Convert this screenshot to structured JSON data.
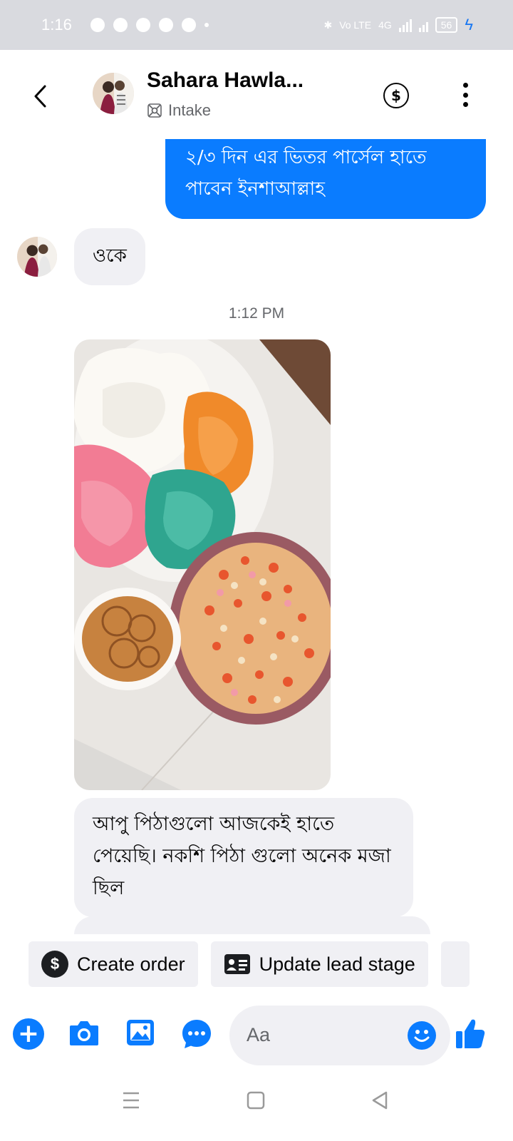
{
  "status_bar": {
    "time": "1:16",
    "network_label": "Vo LTE",
    "data_label": "4G",
    "battery": "56"
  },
  "header": {
    "back_icon": "chevron-left-icon",
    "contact_name": "Sahara Hawla...",
    "subtitle": "Intake",
    "subtitle_icon": "intake-icon",
    "payment_icon": "dollar-circle-icon",
    "more_icon": "more-vertical-icon"
  },
  "messages": {
    "outgoing_text": "২/৩ দিন এর ভিতর পার্সেল হাতে পাবেন ইনশাআল্লাহ",
    "incoming_1": "ওকে",
    "timestamp": "1:12 PM",
    "incoming_2": "আপু পিঠাগুলো আজকেই হাতে পেয়েছি। নকশি পিঠা গুলো অনেক মজা ছিল"
  },
  "quick_actions": {
    "create_order": "Create order",
    "update_lead_stage": "Update lead stage"
  },
  "composer": {
    "placeholder": "Aa"
  },
  "colors": {
    "accent": "#0a7cff",
    "bubble_in": "#f0f0f4",
    "status_bar": "#d9dadf",
    "secondary_text": "#65676b"
  }
}
